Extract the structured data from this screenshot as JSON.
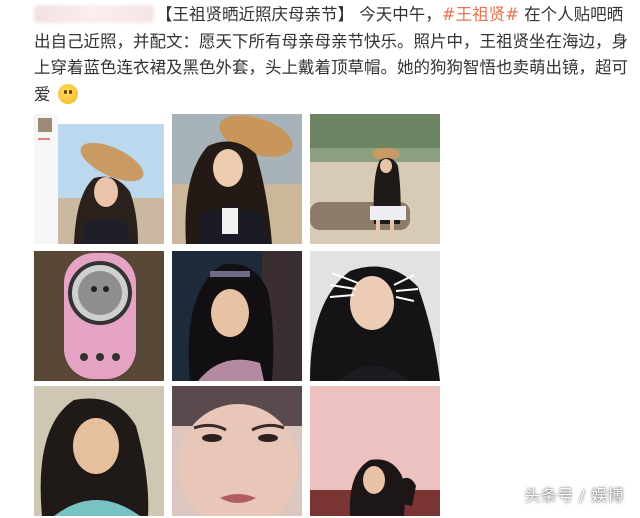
{
  "post": {
    "title": "【王祖贤晒近照庆母亲节】",
    "intro": "今天中午，",
    "hashtag": "#王祖贤#",
    "body": "在个人贴吧晒出自己近照，并配文：愿天下所有母亲母亲节快乐。照片中，王祖贤坐在海边，身上穿着蓝色连衣裙及黑色外套，头上戴着顶草帽。她的狗狗智悟也卖萌出镜，超可爱",
    "emoji_icon": "surprised-face-emoji"
  },
  "photos": [
    {
      "subject": "screenshot-selfie-straw-hat"
    },
    {
      "subject": "portrait-straw-hat-beach"
    },
    {
      "subject": "sitting-on-log-beach"
    },
    {
      "subject": "dog-in-pink-pet-backpack"
    },
    {
      "subject": "movie-still-portrait"
    },
    {
      "subject": "portrait-with-cat-whiskers"
    },
    {
      "subject": "vintage-portrait-teal-top"
    },
    {
      "subject": "close-up-face"
    },
    {
      "subject": "portrait-on-pink-background"
    }
  ],
  "watermark": "头条号 / 娱博",
  "colors": {
    "hashtag": "#eb7350",
    "text": "#333333"
  }
}
